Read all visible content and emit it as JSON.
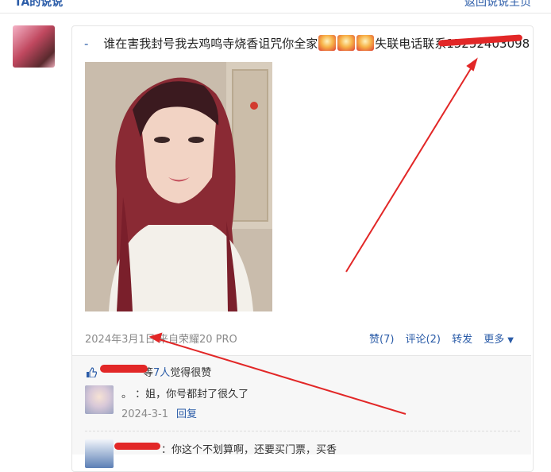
{
  "header": {
    "title": "TA的说说",
    "back_link": "返回说说主页"
  },
  "post": {
    "dash": "-",
    "text_before": "谁在害我封号我去鸡鸣寺烧香诅咒你全家",
    "text_after": "失联电话联系15252403098",
    "emoji": "fa-emoji",
    "date": "2024年3月1日",
    "source": "来自荣耀20 PRO",
    "actions": {
      "like": "赞(7)",
      "comment": "评论(2)",
      "forward": "转发",
      "more": "更多"
    }
  },
  "likes": {
    "prefix": "等",
    "count": "7人",
    "suffix": "觉得很赞"
  },
  "comments": [
    {
      "text": "。 ：姐，你号都封了很久了",
      "date": "2024-3-1",
      "reply": "回复"
    },
    {
      "text": "：你这个不划算啊，还要买门票，买香"
    }
  ],
  "colors": {
    "link": "#2b5ca8",
    "annotation": "#e22727"
  }
}
